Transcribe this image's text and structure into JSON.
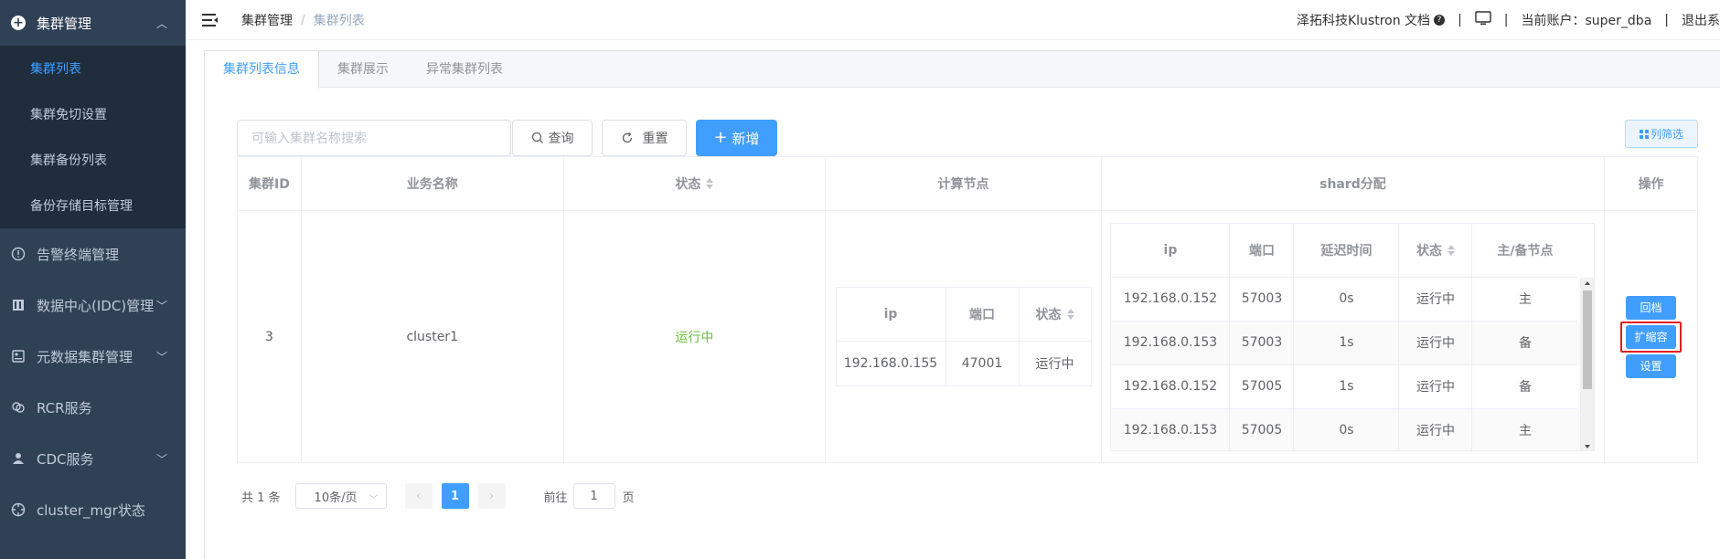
{
  "sidebar": {
    "top_menu": {
      "label": "集群管理",
      "icon": "plus-circle-icon"
    },
    "sub_items": [
      {
        "label": "集群列表",
        "active": true
      },
      {
        "label": "集群免切设置"
      },
      {
        "label": "集群备份列表"
      },
      {
        "label": "备份存储目标管理"
      }
    ],
    "items": [
      {
        "label": "告警终端管理",
        "icon": "alert-icon",
        "has_children": false
      },
      {
        "label": "数据中心(IDC)管理",
        "icon": "building-icon",
        "has_children": true
      },
      {
        "label": "元数据集群管理",
        "icon": "metadata-icon",
        "has_children": true
      },
      {
        "label": "RCR服务",
        "icon": "link-icon",
        "has_children": false
      },
      {
        "label": "CDC服务",
        "icon": "user-icon",
        "has_children": true
      },
      {
        "label": "cluster_mgr状态",
        "icon": "target-icon",
        "has_children": false
      }
    ]
  },
  "header": {
    "breadcrumb": [
      "集群管理",
      "集群列表"
    ],
    "docs_link": "泽拓科技Klustron 文档",
    "account_label": "当前账户：super_dba",
    "logout": "退出系"
  },
  "tabs": [
    "集群列表信息",
    "集群展示",
    "异常集群列表"
  ],
  "toolbar": {
    "search_placeholder": "可输入集群名称搜索",
    "query_label": "查询",
    "reset_label": "重置",
    "add_label": "新增",
    "column_filter_label": "列筛选"
  },
  "table": {
    "headers": {
      "cluster_id": "集群ID",
      "business_name": "业务名称",
      "status": "状态",
      "compute_nodes": "计算节点",
      "shard": "shard分配",
      "actions": "操作"
    },
    "row": {
      "cluster_id": "3",
      "business_name": "cluster1",
      "status": "运行中"
    },
    "compute": {
      "headers": [
        "ip",
        "端口",
        "状态"
      ],
      "rows": [
        {
          "ip": "192.168.0.155",
          "port": "47001",
          "status": "运行中"
        }
      ]
    },
    "shard": {
      "headers": [
        "ip",
        "端口",
        "延迟时间",
        "状态",
        "主/备节点"
      ],
      "rows": [
        {
          "ip": "192.168.0.152",
          "port": "57003",
          "delay": "0s",
          "status": "运行中",
          "role": "主"
        },
        {
          "ip": "192.168.0.153",
          "port": "57003",
          "delay": "1s",
          "status": "运行中",
          "role": "备"
        },
        {
          "ip": "192.168.0.152",
          "port": "57005",
          "delay": "1s",
          "status": "运行中",
          "role": "备"
        },
        {
          "ip": "192.168.0.153",
          "port": "57005",
          "delay": "0s",
          "status": "运行中",
          "role": "主"
        }
      ]
    },
    "actions": [
      "回档",
      "扩缩容",
      "设置"
    ]
  },
  "pagination": {
    "total": "共 1 条",
    "page_size": "10条/页",
    "current_page": "1",
    "goto_prefix": "前往",
    "goto_value": "1",
    "goto_suffix": "页"
  },
  "colors": {
    "sidebar_bg": "#304156",
    "primary": "#409eff",
    "success": "#67c23a",
    "highlight_box": "#e02020"
  }
}
